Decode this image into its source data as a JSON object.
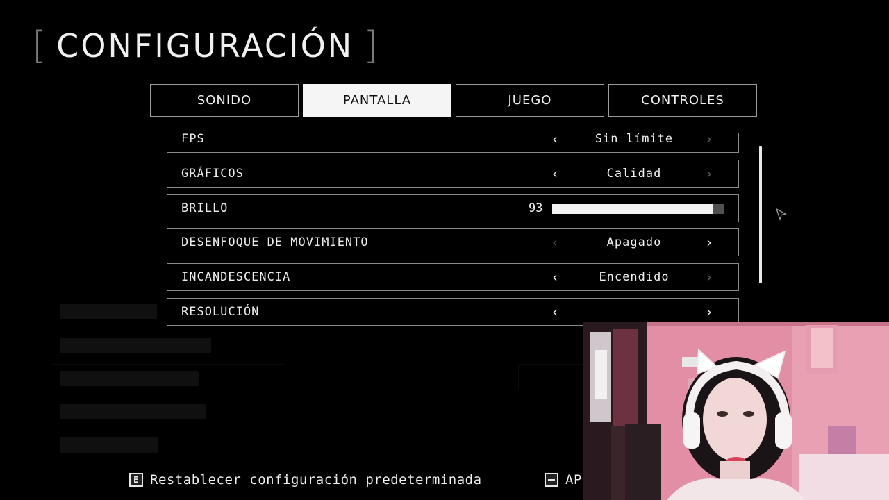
{
  "title": "CONFIGURACIÓN",
  "tabs": [
    {
      "label": "SONIDO",
      "active": false
    },
    {
      "label": "PANTALLA",
      "active": true
    },
    {
      "label": "JUEGO",
      "active": false
    },
    {
      "label": "CONTROLES",
      "active": false
    }
  ],
  "settings": {
    "fps": {
      "label": "FPS",
      "value": "Sin límite"
    },
    "graficos": {
      "label": "GRÁFICOS",
      "value": "Calidad"
    },
    "brillo": {
      "label": "BRILLO",
      "value": "93",
      "level_percent": 93
    },
    "desenfoque": {
      "label": "DESENFOQUE DE MOVIMIENTO",
      "value": "Apagado"
    },
    "incandescencia": {
      "label": "INCANDESCENCIA",
      "value": "Encendido"
    },
    "resolucion": {
      "label": "RESOLUCIÓN",
      "value": ""
    }
  },
  "hints": {
    "reset_key": "E",
    "reset_label": "Restablecer configuración predeterminada",
    "apply_label": "AP"
  },
  "colors": {
    "background": "#000000",
    "tab_active_bg": "#f5f5f5",
    "border": "#8a8a8a",
    "slider_fill": "#f2f2f2",
    "slider_track": "#505050"
  }
}
